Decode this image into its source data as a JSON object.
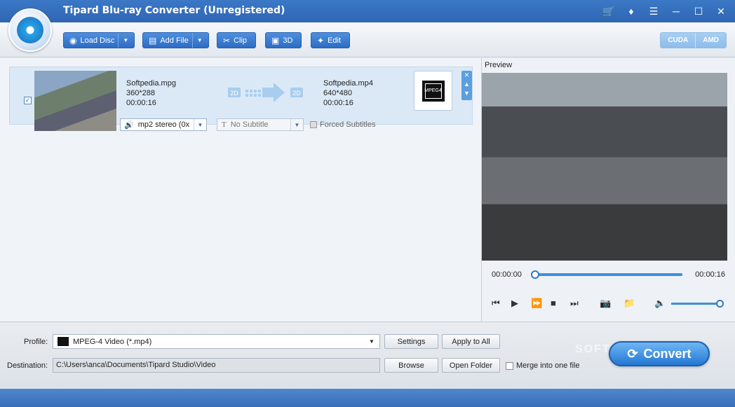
{
  "window": {
    "title": "Tipard Blu-ray Converter (Unregistered)"
  },
  "titlebar_icons": [
    "cart-icon",
    "key-icon",
    "feedback-icon",
    "minimize-icon",
    "maximize-icon",
    "close-icon"
  ],
  "toolbar": {
    "load_disc": "Load Disc",
    "add_file": "Add File",
    "clip": "Clip",
    "threed": "3D",
    "edit": "Edit",
    "cuda": "CUDA",
    "amd": "AMD"
  },
  "file": {
    "checked": true,
    "source": {
      "name": "Softpedia.mpg",
      "resolution": "360*288",
      "duration": "00:00:16"
    },
    "output": {
      "name": "Softpedia.mp4",
      "resolution": "640*480",
      "duration": "00:00:16"
    },
    "arrow_left": "2D",
    "arrow_right": "2D",
    "format_icon": "MPEG4",
    "audio": "mp2 stereo (0x",
    "subtitle": "No Subtitle",
    "forced_subtitles": "Forced Subtitles"
  },
  "preview": {
    "label": "Preview",
    "time_current": "00:00:00",
    "time_total": "00:00:16",
    "progress": 0,
    "volume": 1.0
  },
  "bottom": {
    "profile_label": "Profile:",
    "profile_value": "MPEG-4 Video (*.mp4)",
    "settings": "Settings",
    "apply_all": "Apply to All",
    "destination_label": "Destination:",
    "destination_value": "C:\\Users\\anca\\Documents\\Tipard Studio\\Video",
    "browse": "Browse",
    "open_folder": "Open Folder",
    "merge": "Merge into one file",
    "convert": "Convert",
    "watermark": "SOFTPEDIA"
  }
}
